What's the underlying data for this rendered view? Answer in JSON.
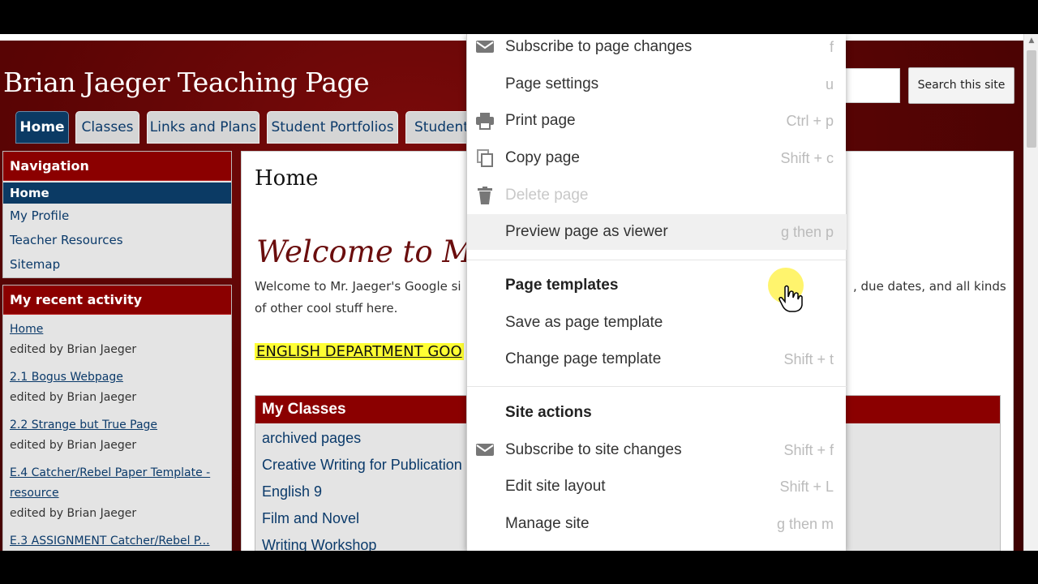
{
  "site": {
    "title": "Brian Jaeger Teaching Page",
    "search_button": "Search this site"
  },
  "tabs": [
    {
      "label": "Home",
      "active": true
    },
    {
      "label": "Classes"
    },
    {
      "label": "Links and Plans"
    },
    {
      "label": "Student Portfolios"
    },
    {
      "label": "Student"
    }
  ],
  "sidebar": {
    "navigation": {
      "header": "Navigation",
      "items": [
        "Home",
        "My Profile",
        "Teacher Resources",
        "Sitemap"
      ]
    },
    "recent_activity": {
      "header": "My recent activity",
      "items": [
        {
          "title": "Home",
          "meta": "edited by Brian Jaeger"
        },
        {
          "title": "2.1 Bogus Webpage",
          "meta": "edited by Brian Jaeger"
        },
        {
          "title": "2.2 Strange but True Page",
          "meta": "edited by Brian Jaeger"
        },
        {
          "title": "E.4 Catcher/Rebel Paper Template -",
          "title2": "resource",
          "meta": "edited by Brian Jaeger"
        },
        {
          "title": "E.3 ASSIGNMENT Catcher/Rebel P..."
        }
      ]
    }
  },
  "main": {
    "page_title": "Home",
    "welcome_heading": "Welcome to M",
    "welcome_text_left": "Welcome to Mr. Jaeger's Google si",
    "welcome_text_right": ", due dates, and all kinds",
    "welcome_text_line2": "of other cool stuff here.",
    "english_dept": "ENGLISH DEPARTMENT GOO",
    "classes": {
      "header": "My Classes",
      "items": [
        "archived pages",
        "Creative Writing for Publication",
        "English 9",
        "Film and Novel",
        "Writing Workshop"
      ]
    }
  },
  "menu": {
    "items": [
      {
        "label": "Subscribe to page changes",
        "shortcut": "f",
        "icon": "mail-icon"
      },
      {
        "label": "Page settings",
        "shortcut": "u"
      },
      {
        "label": "Print page",
        "shortcut": "Ctrl + p",
        "icon": "printer-icon"
      },
      {
        "label": "Copy page",
        "shortcut": "Shift + c",
        "icon": "copy-icon"
      },
      {
        "label": "Delete page",
        "shortcut": "",
        "icon": "trash-icon",
        "disabled": true
      },
      {
        "label": "Preview page as viewer",
        "shortcut": "g then p",
        "hover": true
      }
    ],
    "section_templates": "Page templates",
    "template_items": [
      {
        "label": "Save as page template",
        "shortcut": ""
      },
      {
        "label": "Change page template",
        "shortcut": "Shift + t"
      }
    ],
    "section_site": "Site actions",
    "site_items": [
      {
        "label": "Subscribe to site changes",
        "shortcut": "Shift + f",
        "icon": "mail-icon"
      },
      {
        "label": "Edit site layout",
        "shortcut": "Shift + L"
      },
      {
        "label": "Manage site",
        "shortcut": "g then m"
      }
    ]
  },
  "colors": {
    "banner": "#5a0404",
    "header_red": "#8b0000",
    "nav_blue": "#0b3a64",
    "highlight_yellow": "#ffff33"
  }
}
